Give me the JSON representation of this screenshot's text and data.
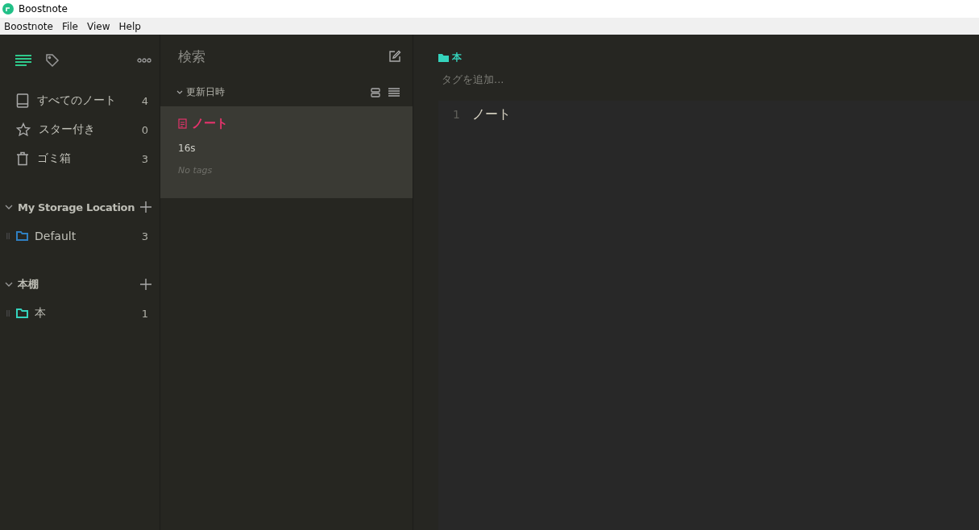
{
  "window": {
    "title": "Boostnote"
  },
  "menu_bar": [
    "Boostnote",
    "File",
    "View",
    "Help"
  ],
  "sidebar": {
    "nav_tabs": [
      {
        "kind": "notes",
        "selected": true
      },
      {
        "kind": "tags",
        "selected": false
      }
    ],
    "items": [
      {
        "kind": "all",
        "label": "すべてのノート",
        "count": "4"
      },
      {
        "kind": "starred",
        "label": "スター付き",
        "count": "0"
      },
      {
        "kind": "trash",
        "label": "ゴミ箱",
        "count": "3"
      }
    ],
    "storages": [
      {
        "name": "My Storage Location",
        "expanded": true,
        "folders": [
          {
            "name": "Default",
            "count": "3",
            "color": "#2f7fc1"
          }
        ]
      },
      {
        "name": "本棚",
        "expanded": true,
        "folders": [
          {
            "name": "本",
            "count": "1",
            "color": "#35d3bd"
          }
        ]
      }
    ]
  },
  "note_list": {
    "search": {
      "placeholder": "検索"
    },
    "sort_label": "更新日時",
    "notes": [
      {
        "title": "ノート",
        "time": "16s",
        "tags": "No tags",
        "selected": true
      }
    ]
  },
  "editor": {
    "folder": "本",
    "tag_field": {
      "placeholder": "タグを追加..."
    },
    "lines": [
      {
        "number": "1",
        "text": "ノート"
      }
    ]
  }
}
